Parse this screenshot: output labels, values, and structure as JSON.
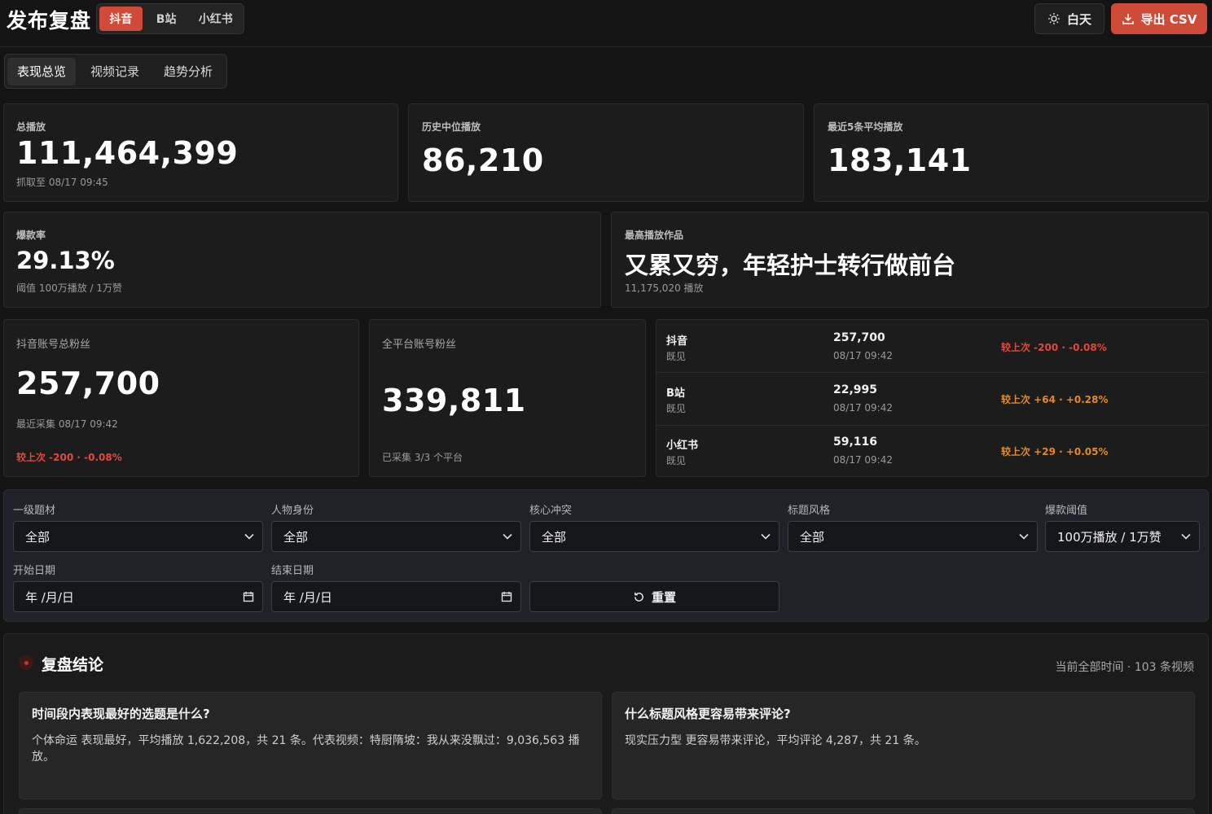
{
  "header": {
    "title": "发布复盘",
    "platform_tabs": [
      "抖音",
      "B站",
      "小红书"
    ],
    "theme_button": "白天",
    "export_button": "导出 CSV"
  },
  "view_tabs": [
    "表现总览",
    "视频记录",
    "趋势分析"
  ],
  "stats": {
    "total_plays": {
      "label": "总播放",
      "value": "111,464,399",
      "note": "抓取至 08/17 09:45"
    },
    "median_plays": {
      "label": "历史中位播放",
      "value": "86,210"
    },
    "recent5_avg": {
      "label": "最近5条平均播放",
      "value": "183,141"
    },
    "hit_rate": {
      "label": "爆款率",
      "value": "29.13%",
      "note": "阈值 100万播放 / 1万赞"
    },
    "top_video": {
      "label": "最高播放作品",
      "value": "又累又穷，年轻护士转行做前台",
      "note": "11,175,020 播放"
    }
  },
  "fans": {
    "douyin_total": {
      "label": "抖音账号总粉丝",
      "value": "257,700",
      "note": "最近采集 08/17 09:42",
      "delta": "较上次 -200 · -0.08%"
    },
    "all_total": {
      "label": "全平台账号粉丝",
      "value": "339,811",
      "note": "已采集 3/3 个平台"
    },
    "platforms": [
      {
        "name": "抖音",
        "sub": "既见",
        "value": "257,700",
        "time": "08/17 09:42",
        "delta": "较上次 -200 · -0.08%",
        "trend": "down"
      },
      {
        "name": "B站",
        "sub": "既见",
        "value": "22,995",
        "time": "08/17 09:42",
        "delta": "较上次 +64 · +0.28%",
        "trend": "up"
      },
      {
        "name": "小红书",
        "sub": "既见",
        "value": "59,116",
        "time": "08/17 09:42",
        "delta": "较上次 +29 · +0.05%",
        "trend": "up"
      }
    ]
  },
  "filters": {
    "topic": {
      "label": "一级题材",
      "value": "全部"
    },
    "identity": {
      "label": "人物身份",
      "value": "全部"
    },
    "conflict": {
      "label": "核心冲突",
      "value": "全部"
    },
    "title_style": {
      "label": "标题风格",
      "value": "全部"
    },
    "hit_threshold": {
      "label": "爆款阈值",
      "value": "100万播放 / 1万赞"
    },
    "start_date": {
      "label": "开始日期",
      "value": "年 /月/日"
    },
    "end_date": {
      "label": "结束日期",
      "value": "年 /月/日"
    },
    "reset_button": "重置"
  },
  "review": {
    "title": "复盘结论",
    "meta": "当前全部时间 · 103 条视频",
    "cards": [
      {
        "q": "时间段内表现最好的选题是什么?",
        "a": "个体命运 表现最好，平均播放 1,622,208，共 21 条。代表视频：特厨隋坡：我从来没飘过：9,036,563 播放。"
      },
      {
        "q": "什么标题风格更容易带来评论?",
        "a": "现实压力型 更容易带来评论，平均评论 4,287，共 21 条。"
      }
    ]
  },
  "colors": {
    "accent": "#d04a38",
    "negative": "#e2483c",
    "positive": "#e08a2c",
    "background": "#141414"
  },
  "icons": {
    "theme": "sun-icon",
    "export": "download-icon",
    "reset": "refresh-icon",
    "review": "pin-icon",
    "select": "chevron-down-icon",
    "date": "calendar-icon"
  }
}
